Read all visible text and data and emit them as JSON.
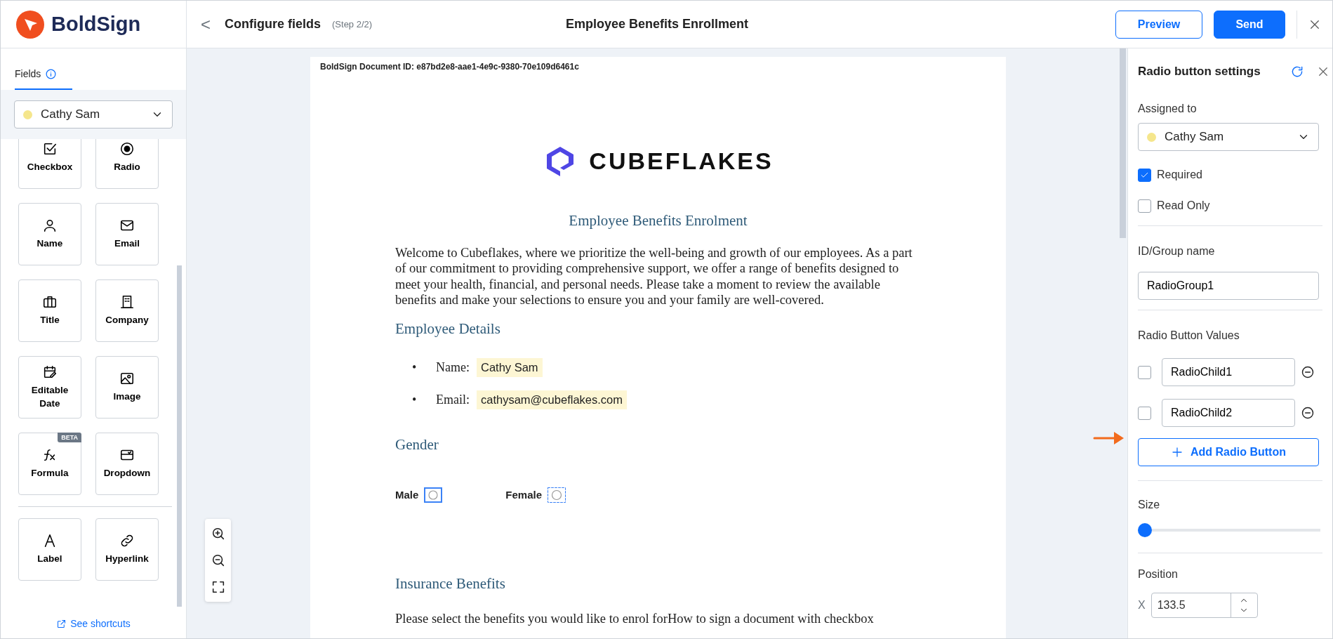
{
  "app": {
    "brand": "BoldSign"
  },
  "header": {
    "back": "<",
    "title": "Configure fields",
    "step": "(Step 2/2)",
    "document_title": "Employee Benefits Enrollment",
    "buttons": [
      {
        "label": "Preview",
        "kind": "outline"
      },
      {
        "label": "Send",
        "kind": "primary"
      }
    ]
  },
  "sidebar": {
    "tabs": [
      {
        "label": "Fields",
        "selected": true
      }
    ],
    "signer": {
      "name": "Cathy Sam",
      "color": "#f5e68c"
    },
    "fields": [
      {
        "label": "Checkbox",
        "kind": "checkbox"
      },
      {
        "label": "Radio",
        "kind": "radio"
      },
      {
        "label": "Name",
        "kind": "person"
      },
      {
        "label": "Email",
        "kind": "mail"
      },
      {
        "label": "Title",
        "kind": "briefcase"
      },
      {
        "label": "Company",
        "kind": "building"
      },
      {
        "label": "Editable Date",
        "kind": "calendar"
      },
      {
        "label": "Image",
        "kind": "image"
      },
      {
        "label": "Formula",
        "kind": "formula",
        "badge": "BETA"
      },
      {
        "label": "Dropdown",
        "kind": "dropdown"
      }
    ],
    "extra_fields": [
      {
        "label": "Label",
        "kind": "letter"
      },
      {
        "label": "Hyperlink",
        "kind": "link"
      }
    ],
    "shortcuts": "See shortcuts"
  },
  "document": {
    "doc_id": "BoldSign Document ID: e87bd2e8-aae1-4e9c-9380-70e109d6461c",
    "logo": "CUBEFLAKES",
    "heading": "Employee Benefits Enrolment",
    "intro": "Welcome to Cubeflakes, where we prioritize the well-being and growth of our employees. As a part of our commitment to providing comprehensive support, we offer a range of benefits designed to meet your health, financial, and personal needs. Please take a moment to review the available benefits and make your selections to ensure you and your family are well-covered.",
    "details_heading": "Employee Details",
    "details": [
      {
        "marker": "•",
        "label": "Name:",
        "value": "Cathy Sam"
      },
      {
        "marker": "•",
        "label": "Email:",
        "value": "cathysam@cubeflakes.com"
      }
    ],
    "gender_heading": "Gender",
    "radio_fields": [
      {
        "label": "Male",
        "active": true
      },
      {
        "label": "Female",
        "active": false
      }
    ],
    "insurance_heading": "Insurance Benefits",
    "insurance_text": "Please select the benefits you would like to enrol forHow to sign a document with checkbox"
  },
  "settings": {
    "title": "Radio button settings",
    "assigned_label": "Assigned to",
    "assigned": {
      "name": "Cathy Sam",
      "color": "#f5e68c"
    },
    "options": [
      {
        "label": "Required",
        "checked": true
      },
      {
        "label": "Read Only",
        "checked": false
      }
    ],
    "group_label": "ID/Group name",
    "group_value": "RadioGroup1",
    "values_label": "Radio Button Values",
    "values": [
      {
        "value": "RadioChild1",
        "checked": false
      },
      {
        "value": "RadioChild2",
        "checked": false
      }
    ],
    "add_button": {
      "label": "Add Radio Button",
      "highlighted": true
    },
    "size_label": "Size",
    "size": {
      "level": 0
    },
    "position_label": "Position",
    "x_label": "X",
    "x_value": "133.5"
  }
}
